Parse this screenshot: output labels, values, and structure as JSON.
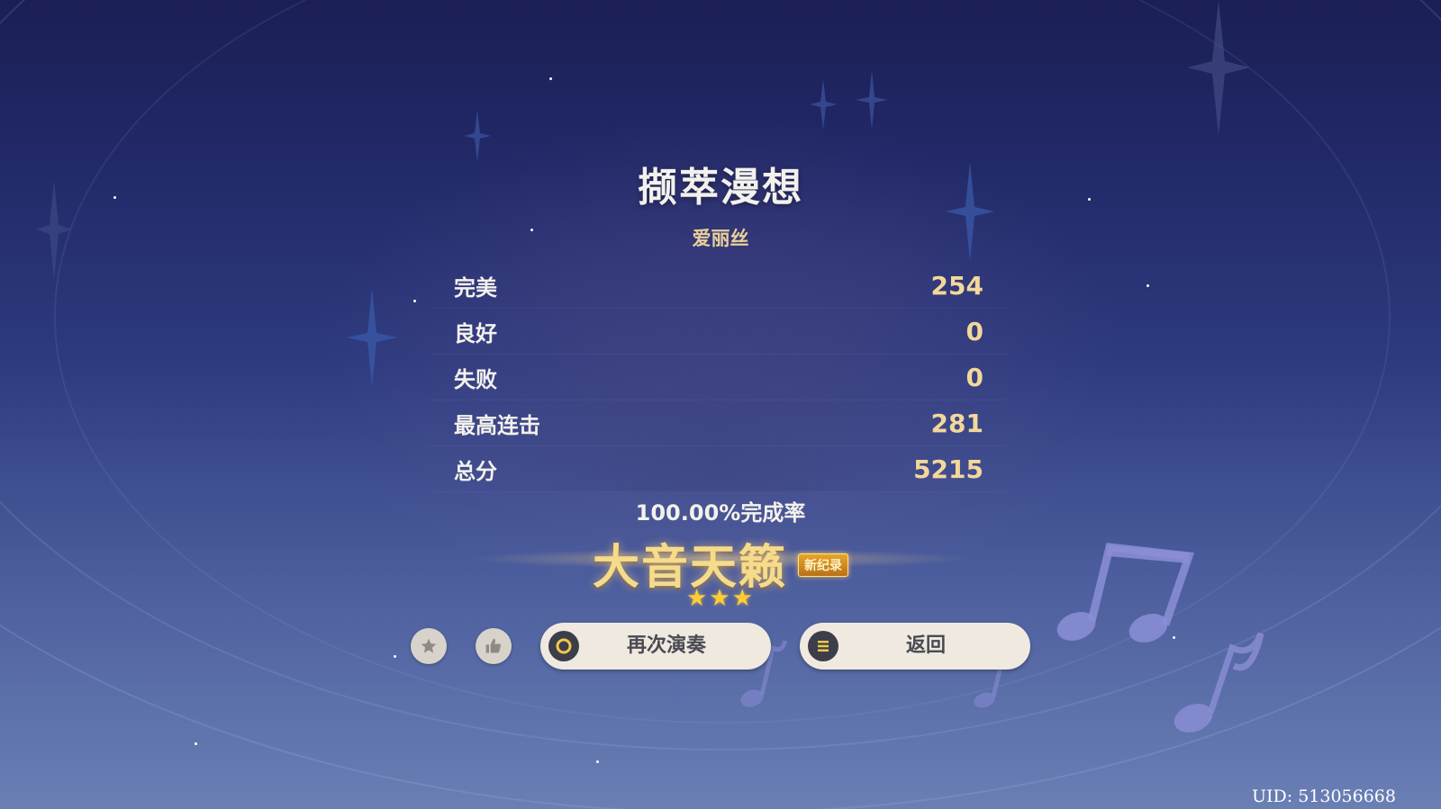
{
  "song": {
    "title": "撷萃漫想",
    "artist": "爱丽丝"
  },
  "stats": [
    {
      "label": "完美",
      "value": "254"
    },
    {
      "label": "良好",
      "value": "0"
    },
    {
      "label": "失败",
      "value": "0"
    },
    {
      "label": "最高连击",
      "value": "281"
    },
    {
      "label": "总分",
      "value": "5215"
    }
  ],
  "result": {
    "completion": "100.00%完成率",
    "rank": "大音天籁",
    "new_record_badge": "新纪录",
    "stars_earned": 3,
    "stars_glyphs": "★★★"
  },
  "actions": {
    "favorite_icon": "star-icon",
    "like_icon": "thumbs-up-icon",
    "replay_label": "再次演奏",
    "replay_icon": "circle-button-icon",
    "back_label": "返回",
    "back_icon": "menu-lines-icon"
  },
  "footer": {
    "uid": "UID: 513056668"
  },
  "colors": {
    "background_top": "#1b1f55",
    "background_bottom": "#6a7fb4",
    "value_gold": "#f2d89a",
    "rank_gold": "#f6db8a",
    "button_bg": "#efe9df"
  }
}
